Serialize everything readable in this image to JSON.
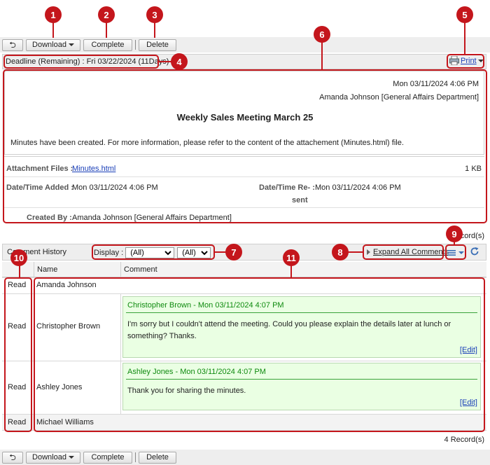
{
  "toolbar": {
    "back_label": "↰",
    "download_label": "Download",
    "complete_label": "Complete",
    "delete_label": "Delete"
  },
  "deadline": {
    "label": "Deadline (Remaining) :",
    "value": "Fri 03/22/2024 (11Days)"
  },
  "print_label": "Print",
  "message": {
    "datetime": "Mon 03/11/2024 4:06 PM",
    "sender": "Amanda Johnson [General Affairs Department]",
    "title": "Weekly Sales Meeting March 25",
    "body": "Minutes have been created. For more information, please refer to the content of the attachement (Minutes.html) file."
  },
  "details": {
    "attachment_label": "Attachment Files :",
    "attachment_file": "Minutes.html",
    "attachment_size": "1 KB",
    "added_label": "Date/Time Added :",
    "added_value": "Mon 03/11/2024 4:06 PM",
    "resent_label_1": "Date/Time Re- :",
    "resent_label_2": "sent",
    "resent_value": "Mon 03/11/2024 4:06 PM",
    "created_label": "Created By :",
    "created_value": "Amanda Johnson [General Affairs Department]"
  },
  "records_top": "ecord(s)",
  "records_bottom": "4 Record(s)",
  "history": {
    "title": "Comment History",
    "display_label": "Display :",
    "filter1": "(All)",
    "filter2": "(All)",
    "expand_label": "Expand All Comments",
    "col_name": "Name",
    "col_comment": "Comment",
    "rows": [
      {
        "status": "Read",
        "name": "Amanda Johnson"
      },
      {
        "status": "Read",
        "name": "Christopher Brown",
        "comment_head": "Christopher Brown  - Mon 03/11/2024 4:07 PM",
        "comment_body": "I'm sorry but I couldn't attend the meeting. Could you please explain the details later at lunch or something? Thanks.",
        "edit": "[Edit]"
      },
      {
        "status": "Read",
        "name": "Ashley Jones",
        "comment_head": "Ashley Jones  - Mon 03/11/2024 4:07 PM",
        "comment_body": "Thank you for sharing the minutes.",
        "edit": "[Edit]"
      },
      {
        "status": "Read",
        "name": "Michael Williams"
      }
    ]
  },
  "callouts": [
    "1",
    "2",
    "3",
    "4",
    "5",
    "6",
    "7",
    "8",
    "9",
    "10",
    "11"
  ],
  "colors": {
    "callout": "#c4161c",
    "comment_bg": "#eaffe3",
    "comment_text": "#0f8a0f",
    "link": "#1a3fb8"
  }
}
